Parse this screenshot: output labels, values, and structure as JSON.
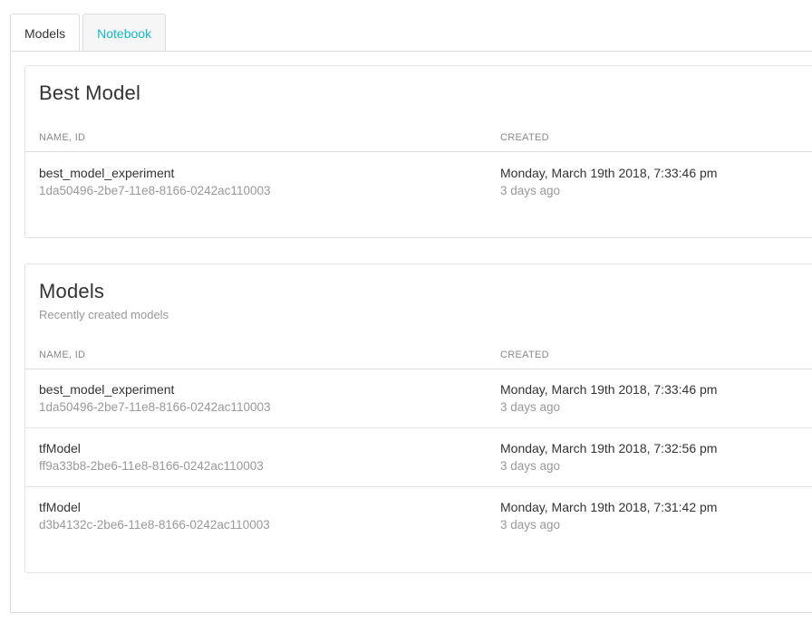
{
  "tabs": [
    {
      "label": "Models",
      "active": true
    },
    {
      "label": "Notebook",
      "active": false
    }
  ],
  "best_model": {
    "title": "Best Model",
    "columns": {
      "name": "NAME, ID",
      "created": "CREATED"
    },
    "rows": [
      {
        "name": "best_model_experiment",
        "id": "1da50496-2be7-11e8-8166-0242ac110003",
        "created": "Monday, March 19th 2018, 7:33:46 pm",
        "relative": "3 days ago"
      }
    ]
  },
  "models": {
    "title": "Models",
    "subtitle": "Recently created models",
    "columns": {
      "name": "NAME, ID",
      "created": "CREATED"
    },
    "rows": [
      {
        "name": "best_model_experiment",
        "id": "1da50496-2be7-11e8-8166-0242ac110003",
        "created": "Monday, March 19th 2018, 7:33:46 pm",
        "relative": "3 days ago"
      },
      {
        "name": "tfModel",
        "id": "ff9a33b8-2be6-11e8-8166-0242ac110003",
        "created": "Monday, March 19th 2018, 7:32:56 pm",
        "relative": "3 days ago"
      },
      {
        "name": "tfModel",
        "id": "d3b4132c-2be6-11e8-8166-0242ac110003",
        "created": "Monday, March 19th 2018, 7:31:42 pm",
        "relative": "3 days ago"
      }
    ]
  },
  "colors": {
    "accent": "#13b8c9",
    "text": "#333333",
    "muted": "#999999",
    "border": "#dddddd"
  }
}
